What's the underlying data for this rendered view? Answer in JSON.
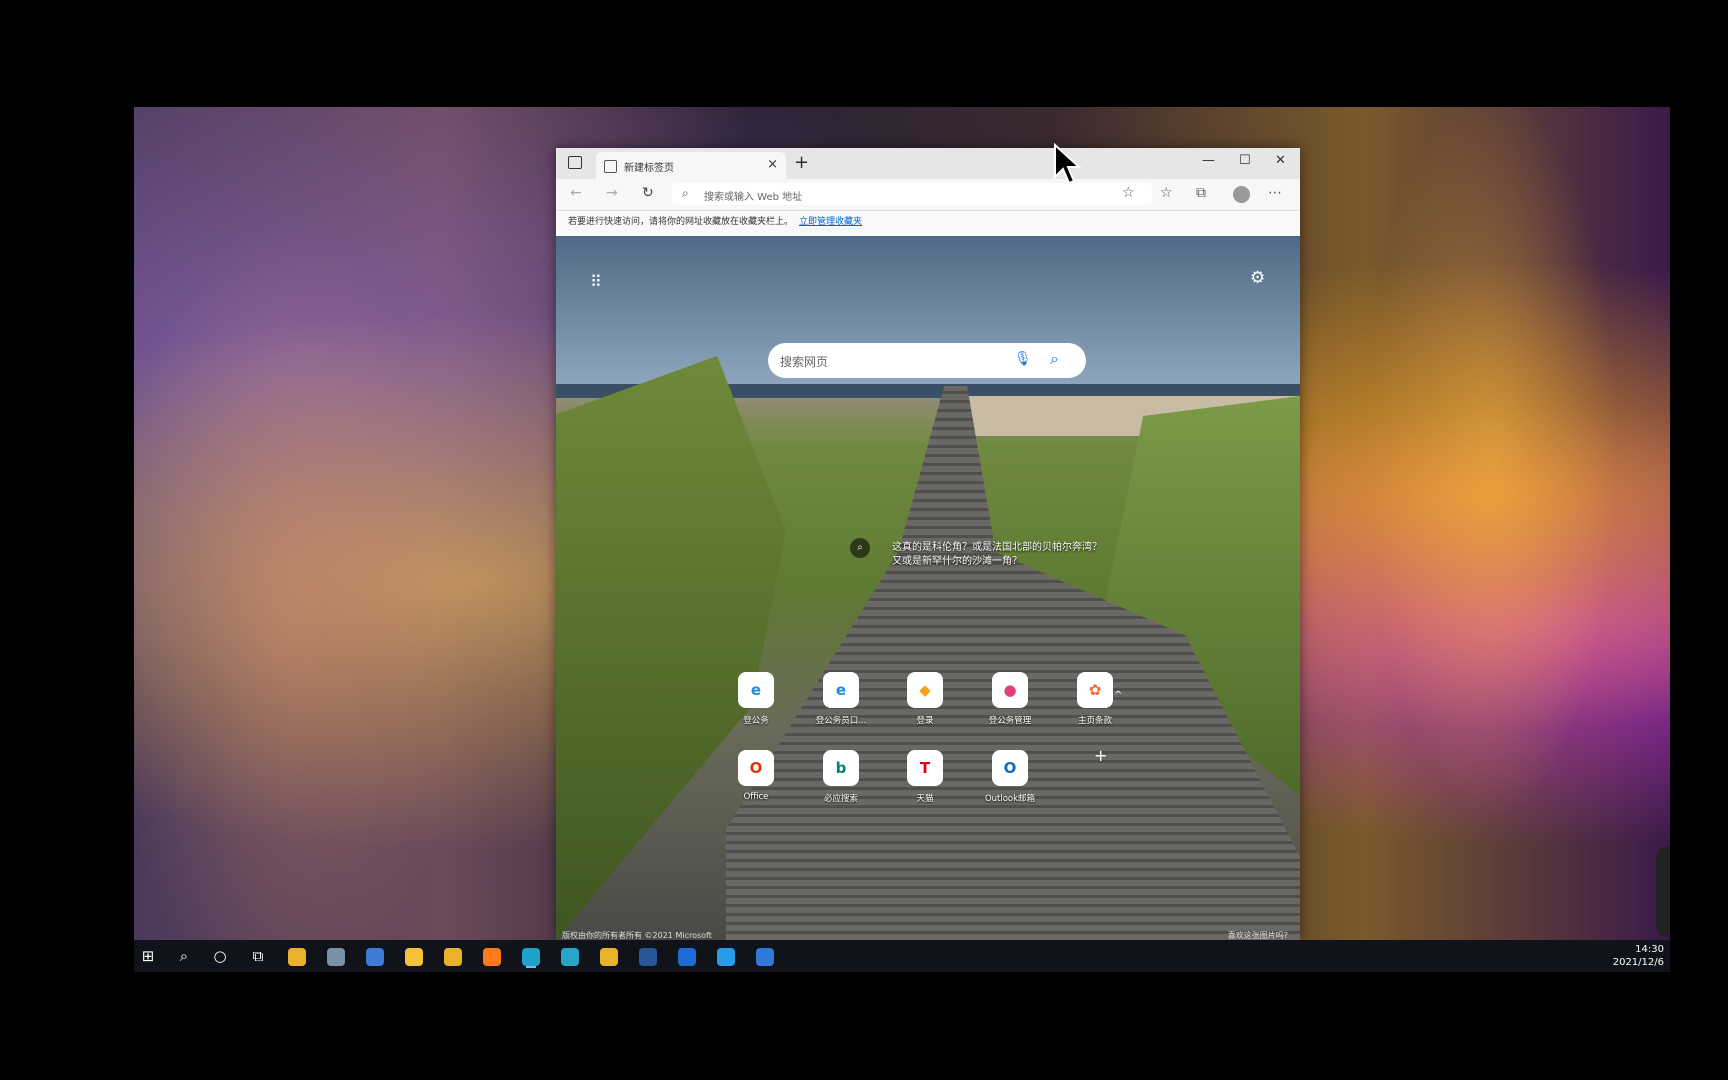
{
  "browser": {
    "tab_title": "新建标签页",
    "tab_close": "×",
    "new_tab": "+",
    "window": {
      "minimize": "—",
      "maximize": "☐",
      "close": "✕"
    },
    "address_placeholder": "搜索或输入 Web 地址",
    "favorites_bar_text": "若要进行快速访问，请将你的网址收藏放在收藏夹栏上。",
    "favorites_bar_link": "立即管理收藏夹"
  },
  "newtab": {
    "search_placeholder": "搜索网页",
    "caption": "这真的是科伦角？或是法国北部的贝帕尔奔湾？又或是新罕什尔的沙滩一角？",
    "quick_links": [
      {
        "label": "登公务",
        "icon": "edge-blue-icon",
        "color": "#1e88e5",
        "glyph": "e"
      },
      {
        "label": "登公务员口...",
        "icon": "edge-blue-icon",
        "color": "#1e88e5",
        "glyph": "e"
      },
      {
        "label": "登录",
        "icon": "box-cube-icon",
        "color": "#f4a21a",
        "glyph": "◆"
      },
      {
        "label": "登公务管理",
        "icon": "pink-circle-icon",
        "color": "#e0417a",
        "glyph": "●"
      },
      {
        "label": "主页条款",
        "icon": "orange-flower-icon",
        "color": "#ef6c3a",
        "glyph": "✿"
      },
      {
        "label": "Office",
        "icon": "office-icon",
        "color": "#d83b01",
        "glyph": "O"
      },
      {
        "label": "必应搜索",
        "icon": "bing-icon",
        "color": "#008373",
        "glyph": "b"
      },
      {
        "label": "天猫",
        "icon": "tmall-icon",
        "color": "#e4001b",
        "glyph": "T"
      },
      {
        "label": "Outlook邮箱",
        "icon": "outlook-icon",
        "color": "#0f6cbd",
        "glyph": "O"
      }
    ],
    "add_site": "+",
    "footer_left": "版权由你的所有者所有 ©2021 Microsoft",
    "footer_right": "喜欢这张图片吗?"
  },
  "taskbar": {
    "time": "14:30",
    "date": "2021/12/6",
    "apps": [
      {
        "name": "chrome-icon",
        "color": "#e8b32a"
      },
      {
        "name": "app-bird-icon",
        "color": "#7a8fa8"
      },
      {
        "name": "app-share-icon",
        "color": "#3d7bd6"
      },
      {
        "name": "file-explorer-icon",
        "color": "#f2c23a"
      },
      {
        "name": "chrome-2-icon",
        "color": "#e8b32a"
      },
      {
        "name": "firefox-icon",
        "color": "#ff7a1a"
      },
      {
        "name": "edge-icon",
        "color": "#1fa2c9"
      },
      {
        "name": "edge-search-icon",
        "color": "#28a6c8"
      },
      {
        "name": "chrome-3-icon",
        "color": "#e8b32a"
      },
      {
        "name": "word-icon",
        "color": "#2b579a"
      },
      {
        "name": "app-screen-icon",
        "color": "#1e6bd6"
      },
      {
        "name": "app-blue-icon",
        "color": "#2a9be8"
      },
      {
        "name": "app-shield-icon",
        "color": "#2f79d8"
      }
    ]
  }
}
